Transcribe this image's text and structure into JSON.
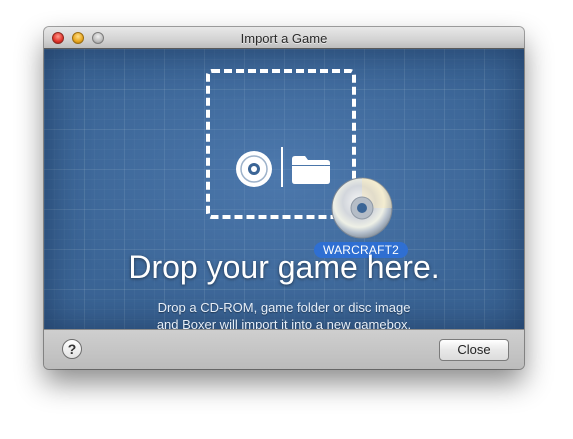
{
  "window": {
    "title": "Import a Game"
  },
  "drop_area": {
    "headline": "Drop your game here.",
    "subtext_line1": "Drop a CD-ROM, game folder or disc image",
    "subtext_line2": "and Boxer will import it into a new gamebox.",
    "dragged_item_label": "WARCRAFT2",
    "icons": [
      "cd-icon",
      "folder-icon",
      "disc-icon"
    ],
    "background_color": "#3b6596",
    "label_color": "#2f6fd2"
  },
  "bottombar": {
    "help_label": "?",
    "close_label": "Close"
  }
}
